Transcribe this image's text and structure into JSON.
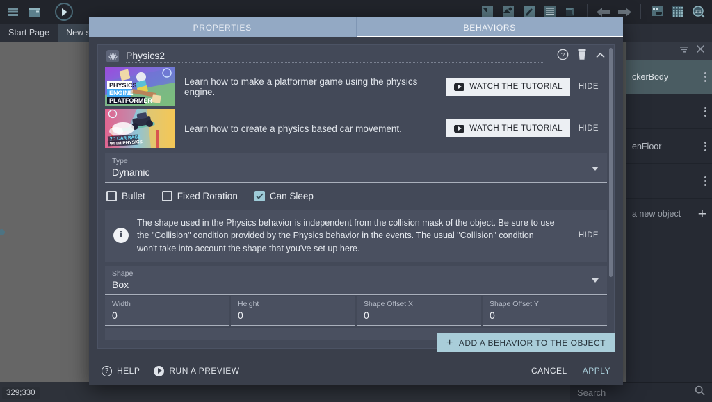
{
  "toolbar": {
    "left_icons": [
      "layers-icon",
      "window-icon"
    ],
    "play_icon": "play-icon",
    "right_icons": [
      "object-editor-icon",
      "object-groups-icon",
      "edit-scene-icon",
      "events-icon",
      "external-layout-icon",
      "undo-icon",
      "redo-icon",
      "debug-icon",
      "grid-icon",
      "zoom-reset-icon"
    ]
  },
  "tabs": [
    {
      "label": "Start Page",
      "active": false
    },
    {
      "label": "New sce",
      "active": true
    }
  ],
  "canvas": {
    "coordinates": "329;330"
  },
  "objects_panel": {
    "filter_icon": "filter-icon",
    "close_icon": "close-icon",
    "items": [
      {
        "label": "ckerBody",
        "selected": true
      },
      {
        "label": "",
        "selected": false
      },
      {
        "label": "enFloor",
        "selected": false
      },
      {
        "label": "",
        "selected": false
      }
    ],
    "add_label": "a new object",
    "add_icon": "plus-icon"
  },
  "search": {
    "placeholder": "Search",
    "icon": "search-icon"
  },
  "dialog": {
    "tabs": [
      {
        "label": "PROPERTIES",
        "active": false
      },
      {
        "label": "BEHAVIORS",
        "active": true
      }
    ],
    "behavior": {
      "icon": "physics-atom-icon",
      "name": "Physics2",
      "help_icon": "help-circle-icon",
      "delete_icon": "trash-icon",
      "collapse_icon": "chevron-up-icon"
    },
    "tutorials": [
      {
        "thumb_lines": [
          "PHYSICS",
          "ENGINE",
          "PLATFORMER"
        ],
        "text": "Learn how to make a platformer game using the physics engine.",
        "watch_label": "WATCH THE TUTORIAL",
        "hide_label": "HIDE",
        "play_icon": "youtube-play-icon"
      },
      {
        "thumb_lines": [
          "2D CAR RACE",
          "WITH PHYSICS"
        ],
        "text": "Learn how to create a physics based car movement.",
        "watch_label": "WATCH THE TUTORIAL",
        "hide_label": "HIDE",
        "play_icon": "youtube-play-icon"
      }
    ],
    "type_field": {
      "label": "Type",
      "value": "Dynamic",
      "caret": "chevron-down-icon"
    },
    "checkboxes": [
      {
        "label": "Bullet",
        "checked": false
      },
      {
        "label": "Fixed Rotation",
        "checked": false
      },
      {
        "label": "Can Sleep",
        "checked": true
      }
    ],
    "info": {
      "icon": "info-icon",
      "text": "The shape used in the Physics behavior is independent from the collision mask of the object. Be sure to use the \"Collision\" condition provided by the Physics behavior in the events. The usual \"Collision\" condition won't take into account the shape that you've set up here.",
      "hide_label": "HIDE"
    },
    "shape_field": {
      "label": "Shape",
      "value": "Box",
      "caret": "chevron-down-icon"
    },
    "dimension_fields": [
      {
        "label": "Width",
        "value": "0"
      },
      {
        "label": "Height",
        "value": "0"
      },
      {
        "label": "Shape Offset X",
        "value": "0"
      },
      {
        "label": "Shape Offset Y",
        "value": "0"
      }
    ],
    "add_behavior": {
      "label": "ADD A BEHAVIOR TO THE OBJECT",
      "icon": "plus-icon"
    },
    "footer": {
      "help_label": "HELP",
      "help_icon": "help-circle-icon",
      "preview_label": "RUN A PREVIEW",
      "preview_icon": "play-icon",
      "cancel_label": "CANCEL",
      "apply_label": "APPLY"
    }
  },
  "colors": {
    "accent": "#a9cdd9",
    "tab_header": "#93a9c4",
    "dialog_bg": "#3a3f4b",
    "field_bg": "#4a5060"
  }
}
